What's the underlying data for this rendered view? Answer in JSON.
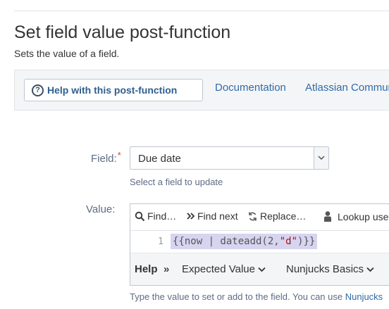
{
  "page": {
    "title": "Set field value post-function",
    "subtitle": "Sets the value of a field."
  },
  "help_bar": {
    "help_button_label": "Help with this post-function",
    "documentation_link": "Documentation",
    "community_link": "Atlassian Community"
  },
  "field": {
    "label": "Field:",
    "required_mark": "*",
    "selected_value": "Due date",
    "hint": "Select a field to update"
  },
  "value": {
    "label": "Value:",
    "toolbar": {
      "find": "Find…",
      "find_next": "Find next",
      "replace": "Replace…",
      "lookup": "Lookup user"
    },
    "editor": {
      "line_number": "1",
      "code_prefix": "{{now | dateadd(2,",
      "code_string": "\"d\"",
      "code_suffix": ")}}"
    },
    "help_row": {
      "help": "Help",
      "separator": "»",
      "expected_value": "Expected Value",
      "nunjucks_basics": "Nunjucks Basics"
    },
    "hint_prefix": "Type the value to set or add to the field. You can use ",
    "hint_link": "Nunjucks"
  }
}
